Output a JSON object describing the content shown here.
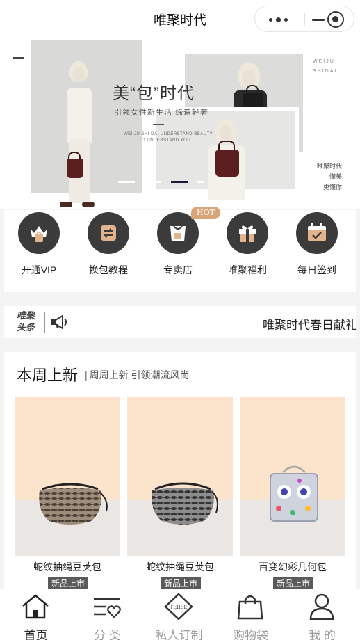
{
  "app": {
    "title": "唯聚时代"
  },
  "banner": {
    "headline": "美“包”时代",
    "subline": "引领女性新生活 缔造轻奢",
    "english_1": "WEI JU SHI DAI UNDERSTAND BEAUTY",
    "english_2": "TO UNDERSTAND YOU",
    "vertical_brand": "WEIJU SHIDAI",
    "side_lines": [
      "唯聚时代",
      "懂美",
      "更懂你"
    ],
    "slide_count": 4,
    "active_slide": 3
  },
  "quick_menu": {
    "items": [
      {
        "label": "开通VIP",
        "icon": "crown-bag-icon"
      },
      {
        "label": "换包教程",
        "icon": "swap-icon"
      },
      {
        "label": "专卖店",
        "icon": "shopping-bag-icon"
      },
      {
        "label": "唯聚福利",
        "icon": "gift-icon"
      },
      {
        "label": "每日签到",
        "icon": "calendar-check-icon"
      }
    ],
    "hot_badge": "HOT"
  },
  "headline_ticker": {
    "logo_line1": "唯聚",
    "logo_line2": "头条",
    "text": "唯聚时代春日献礼"
  },
  "new_arrivals": {
    "title": "本周上新",
    "subtitle": "周周上新 引领潮流风尚",
    "products": [
      {
        "name": "蛇纹抽绳豆荚包",
        "badge": "新品上市"
      },
      {
        "name": "蛇纹抽绳豆荚包",
        "badge": "新品上市"
      },
      {
        "name": "百变幻彩几何包",
        "badge": "新品上市"
      }
    ]
  },
  "tabbar": {
    "tabs": [
      {
        "label": "首页",
        "icon": "home-icon",
        "active": true
      },
      {
        "label": "分 类",
        "icon": "category-list-icon",
        "active": false
      },
      {
        "label": "私人订制",
        "icon": "terse-diamond-icon",
        "active": false
      },
      {
        "label": "购物袋",
        "icon": "shopping-bag-icon",
        "active": false
      },
      {
        "label": "我 的",
        "icon": "user-icon",
        "active": false
      }
    ],
    "terse_logo_text": "TERSE"
  },
  "colors": {
    "accent_gold": "#d9a478",
    "icon_dark": "#3b3b3b",
    "product_bg": "#fce3cc",
    "tab_inactive": "#9a9a9a"
  }
}
